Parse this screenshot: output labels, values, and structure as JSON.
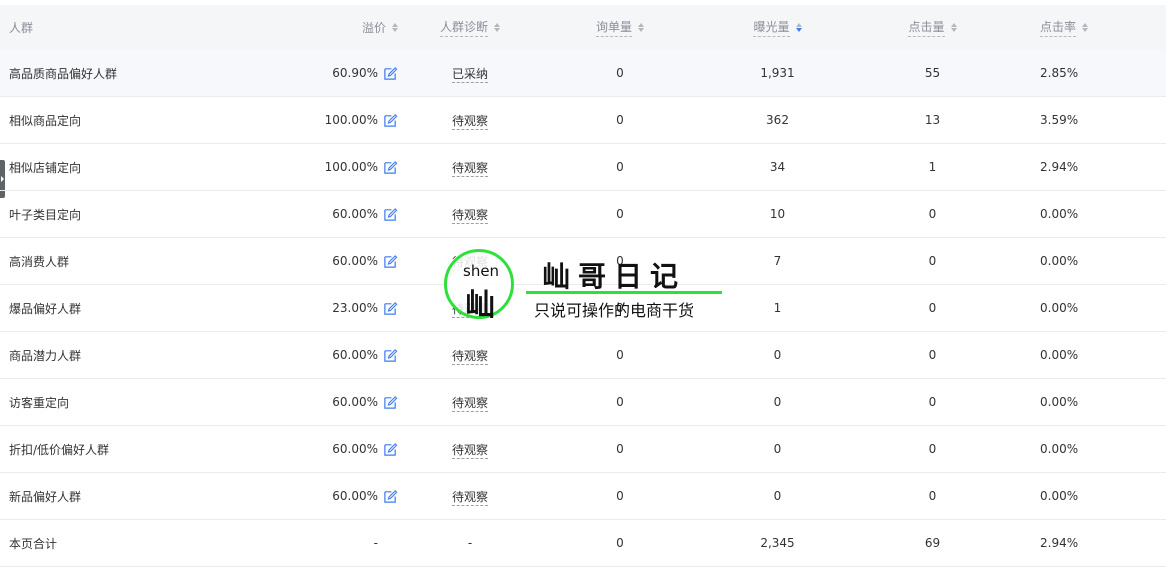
{
  "table": {
    "columns": [
      {
        "label": "人群",
        "sortable": false
      },
      {
        "label": "溢价",
        "sortable": true
      },
      {
        "label": "人群诊断",
        "sortable": true
      },
      {
        "label": "询单量",
        "sortable": true
      },
      {
        "label": "曝光量",
        "sortable": true,
        "active": true
      },
      {
        "label": "点击量",
        "sortable": true
      },
      {
        "label": "点击率",
        "sortable": true
      }
    ],
    "rows": [
      {
        "name": "高品质商品偏好人群",
        "premium": "60.90%",
        "diagnosis": "已采纳",
        "inquiries": "0",
        "impressions": "1,931",
        "clicks": "55",
        "ctr": "2.85%"
      },
      {
        "name": "相似商品定向",
        "premium": "100.00%",
        "diagnosis": "待观察",
        "inquiries": "0",
        "impressions": "362",
        "clicks": "13",
        "ctr": "3.59%"
      },
      {
        "name": "相似店铺定向",
        "premium": "100.00%",
        "diagnosis": "待观察",
        "inquiries": "0",
        "impressions": "34",
        "clicks": "1",
        "ctr": "2.94%"
      },
      {
        "name": "叶子类目定向",
        "premium": "60.00%",
        "diagnosis": "待观察",
        "inquiries": "0",
        "impressions": "10",
        "clicks": "0",
        "ctr": "0.00%"
      },
      {
        "name": "高消费人群",
        "premium": "60.00%",
        "diagnosis": "待观察",
        "inquiries": "0",
        "impressions": "7",
        "clicks": "0",
        "ctr": "0.00%"
      },
      {
        "name": "爆品偏好人群",
        "premium": "23.00%",
        "diagnosis": "待观察",
        "inquiries": "0",
        "impressions": "1",
        "clicks": "0",
        "ctr": "0.00%"
      },
      {
        "name": "商品潜力人群",
        "premium": "60.00%",
        "diagnosis": "待观察",
        "inquiries": "0",
        "impressions": "0",
        "clicks": "0",
        "ctr": "0.00%"
      },
      {
        "name": "访客重定向",
        "premium": "60.00%",
        "diagnosis": "待观察",
        "inquiries": "0",
        "impressions": "0",
        "clicks": "0",
        "ctr": "0.00%"
      },
      {
        "name": "折扣/低价偏好人群",
        "premium": "60.00%",
        "diagnosis": "待观察",
        "inquiries": "0",
        "impressions": "0",
        "clicks": "0",
        "ctr": "0.00%"
      },
      {
        "name": "新品偏好人群",
        "premium": "60.00%",
        "diagnosis": "待观察",
        "inquiries": "0",
        "impressions": "0",
        "clicks": "0",
        "ctr": "0.00%"
      }
    ],
    "total": {
      "name": "本页合计",
      "premium": "-",
      "diagnosis": "-",
      "inquiries": "0",
      "impressions": "2,345",
      "clicks": "69",
      "ctr": "2.94%"
    }
  },
  "icons": {
    "edit": "edit-icon",
    "sort": "sort-icon"
  },
  "colors": {
    "header_bg": "#f5f6f8",
    "edit_icon": "#3d7cf2",
    "sort_active": "#3d7cf2",
    "watermark_green": "#2ee03a"
  },
  "watermark": {
    "pinyin": "shen",
    "char": "屾",
    "title": "屾哥日记",
    "subtitle": "只说可操作的电商干货"
  }
}
